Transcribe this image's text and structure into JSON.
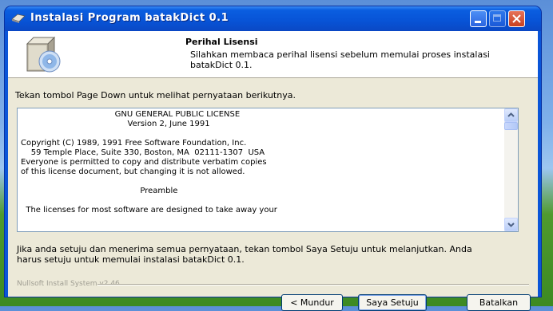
{
  "window": {
    "title": "Instalasi Program batakDict 0.1"
  },
  "header": {
    "title": "Perihal Lisensi",
    "subtitle": "Silahkan membaca perihal lisensi sebelum memulai proses instalasi batakDict 0.1."
  },
  "instruction": "Tekan tombol Page Down untuk melihat pernyataan berikutnya.",
  "license": {
    "text": "                                     GNU GENERAL PUBLIC LICENSE\n                                          Version 2, June 1991\n\nCopyright (C) 1989, 1991 Free Software Foundation, Inc.\n    59 Temple Place, Suite 330, Boston, MA  02111-1307  USA\nEveryone is permitted to copy and distribute verbatim copies\nof this license document, but changing it is not allowed.\n\n                                               Preamble\n\n  The licenses for most software are designed to take away your"
  },
  "agree_text": "Jika anda setuju dan menerima semua pernyataan, tekan tombol Saya Setuju untuk melanjutkan. Anda harus setuju untuk memulai instalasi batakDict 0.1.",
  "branding": "Nullsoft Install System v2.46",
  "buttons": {
    "back": "< Mundur",
    "agree": "Saya Setuju",
    "cancel": "Batalkan"
  }
}
